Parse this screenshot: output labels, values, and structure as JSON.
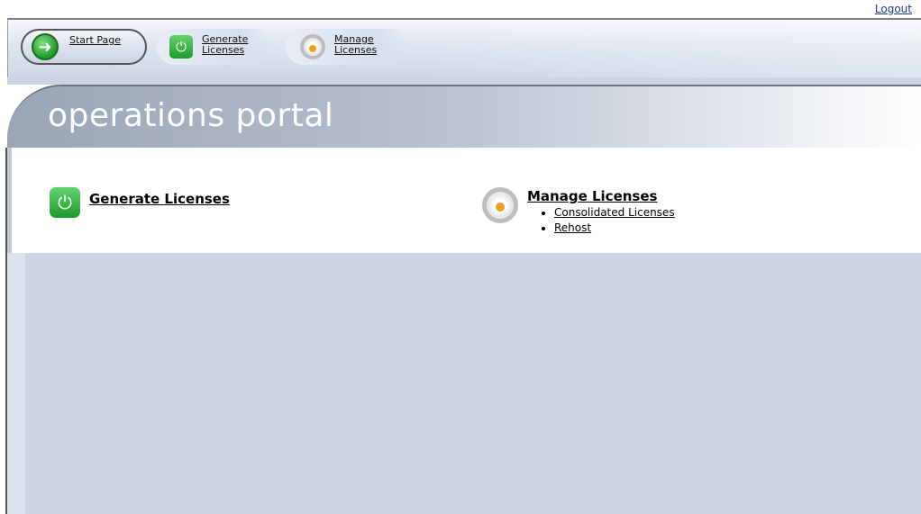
{
  "topbar": {
    "logout_label": "Logout"
  },
  "nav": {
    "tabs": [
      {
        "label": "Start Page",
        "icon": "arrow-right-circle-icon"
      },
      {
        "label_line1": "Generate",
        "label_line2": "Licenses",
        "icon": "power-icon"
      },
      {
        "label_line1": "Manage",
        "label_line2": "Licenses",
        "icon": "cycle-icon"
      }
    ]
  },
  "header": {
    "title": "operations portal"
  },
  "sections": {
    "generate": {
      "title": "Generate Licenses",
      "icon": "power-icon"
    },
    "manage": {
      "title": "Manage Licenses",
      "icon": "cycle-icon",
      "items": [
        {
          "label": "Consolidated Licenses"
        },
        {
          "label": "Rehost"
        }
      ]
    }
  },
  "colors": {
    "nav_bg": "#dfe6f1",
    "lower_bg": "#ccd5e4",
    "logout_link": "#1a3a8a",
    "icon_green": "#1f9a2d",
    "icon_orange": "#f0a020"
  }
}
